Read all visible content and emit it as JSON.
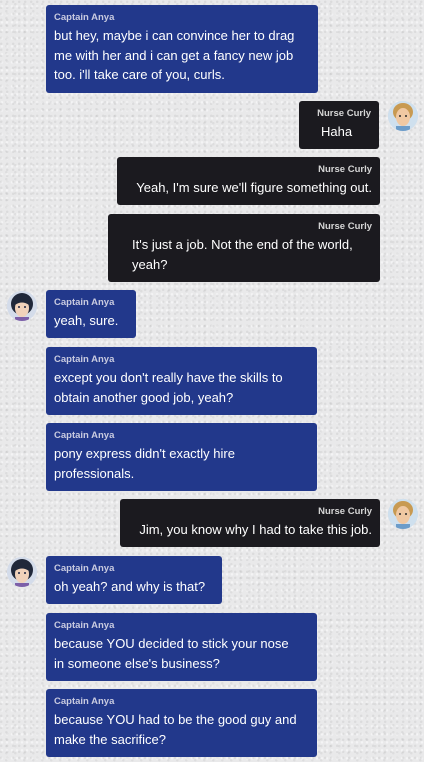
{
  "messages": [
    {
      "sender": "Captain Anya",
      "text": "but hey, maybe i can convince her to drag\nme with her and i can get a fancy new job\ntoo. i'll take care of you, curls."
    },
    {
      "sender": "Nurse Curly",
      "text": "Haha"
    },
    {
      "sender": "Nurse Curly",
      "text": "Yeah, I'm sure we'll figure something out."
    },
    {
      "sender": "Nurse Curly",
      "text": "It's just a job. Not the end of the world,\nyeah?"
    },
    {
      "sender": "Captain Anya",
      "text": "yeah, sure."
    },
    {
      "sender": "Captain Anya",
      "text": "except you don't really have the skills to\nobtain another good job, yeah?"
    },
    {
      "sender": "Captain Anya",
      "text": "pony express didn't exactly hire\nprofessionals."
    },
    {
      "sender": "Nurse Curly",
      "text": "Jim, you know why I had to take this job."
    },
    {
      "sender": "Captain Anya",
      "text": "oh yeah? and why is that?"
    },
    {
      "sender": "Captain Anya",
      "text": "because YOU decided to stick your nose\nin someone else's business?"
    },
    {
      "sender": "Captain Anya",
      "text": "because YOU had to be the good guy and\nmake the sacrifice?"
    }
  ],
  "colors": {
    "anya_bubble": "#22388b",
    "curly_bubble": "#1b1a1f"
  },
  "icons": {
    "anya_avatar": "avatar-captain-anya-icon",
    "curly_avatar": "avatar-nurse-curly-icon"
  }
}
